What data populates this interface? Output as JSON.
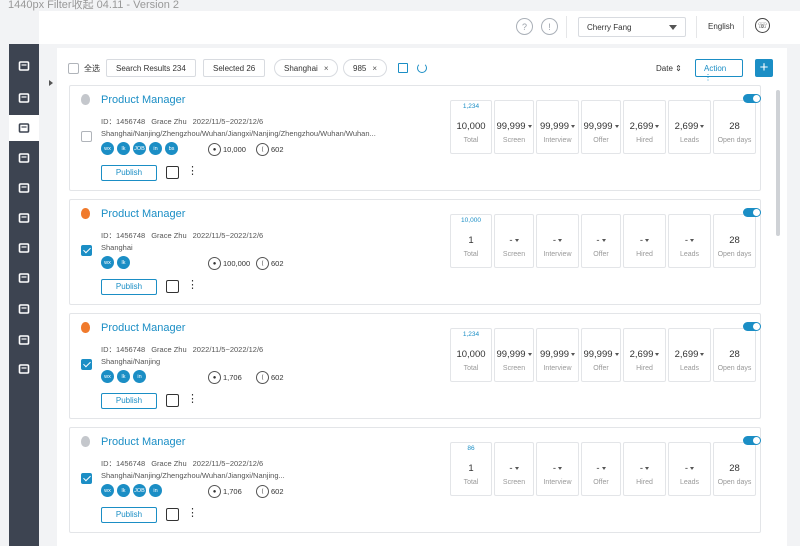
{
  "topcap": "1440px Filter收起 04.11 - Version 2",
  "header": {
    "user": "Cherry Fang",
    "language": "English"
  },
  "sidebar": {
    "icons": [
      "dashboard-icon",
      "contacts-icon",
      "briefcase-icon",
      "users-icon",
      "resume-icon",
      "add-user-icon",
      "report-icon",
      "chart-icon",
      "person-icon",
      "feedback-icon",
      "id-card-icon"
    ],
    "active_index": 2
  },
  "filterbar": {
    "select_all": "全选",
    "search_results": "Search Results 234",
    "selected": "Selected 26",
    "chip_city": "Shanghai",
    "chip_tag": "985",
    "sort": "Date",
    "action": "Action",
    "add": "+"
  },
  "metric_labels": [
    "Total",
    "Screen",
    "Interview",
    "Offer",
    "Hired",
    "Leads",
    "Open days"
  ],
  "cards": [
    {
      "title": "Product Manager",
      "hot": false,
      "checked": false,
      "id": "ID：1456748",
      "owner": "Grace Zhu",
      "date_range": "2022/11/5~2022/12/6",
      "locations": "Shanghai/Nanjing/Zhengzhou/Wuhan/Jiangxi/Nanjing/Zhengzhou/Wuhan/Wuhan...",
      "channels": [
        "wechat",
        "link",
        "job",
        "in",
        "boss"
      ],
      "views": "10,000",
      "shares": "602",
      "publish": "Publish",
      "top_badge": "1,234",
      "metrics": [
        {
          "value": "10,000",
          "dropdown": false
        },
        {
          "value": "99,999",
          "dropdown": true
        },
        {
          "value": "99,999",
          "dropdown": true
        },
        {
          "value": "99,999",
          "dropdown": true
        },
        {
          "value": "2,699",
          "dropdown": true
        },
        {
          "value": "2,699",
          "dropdown": true
        },
        {
          "value": "28",
          "dropdown": false
        }
      ]
    },
    {
      "title": "Product Manager",
      "hot": true,
      "checked": true,
      "id": "ID：1456748",
      "owner": "Grace Zhu",
      "date_range": "2022/11/5~2022/12/6",
      "locations": "Shanghai",
      "channels": [
        "wechat",
        "link"
      ],
      "views": "100,000",
      "shares": "602",
      "publish": "Publish",
      "top_badge": "10,000",
      "metrics": [
        {
          "value": "1",
          "dropdown": false
        },
        {
          "value": "-",
          "dropdown": true
        },
        {
          "value": "-",
          "dropdown": true
        },
        {
          "value": "-",
          "dropdown": true
        },
        {
          "value": "-",
          "dropdown": true
        },
        {
          "value": "-",
          "dropdown": true
        },
        {
          "value": "28",
          "dropdown": false
        }
      ]
    },
    {
      "title": "Product Manager",
      "hot": true,
      "checked": true,
      "id": "ID：1456748",
      "owner": "Grace Zhu",
      "date_range": "2022/11/5~2022/12/6",
      "locations": "Shanghai/Nanjing",
      "channels": [
        "wechat",
        "link",
        "in"
      ],
      "views": "1,706",
      "shares": "602",
      "publish": "Publish",
      "top_badge": "1,234",
      "metrics": [
        {
          "value": "10,000",
          "dropdown": false
        },
        {
          "value": "99,999",
          "dropdown": true
        },
        {
          "value": "99,999",
          "dropdown": true
        },
        {
          "value": "99,999",
          "dropdown": true
        },
        {
          "value": "2,699",
          "dropdown": true
        },
        {
          "value": "2,699",
          "dropdown": true
        },
        {
          "value": "28",
          "dropdown": false
        }
      ]
    },
    {
      "title": "Product Manager",
      "hot": false,
      "checked": true,
      "id": "ID：1456748",
      "owner": "Grace Zhu",
      "date_range": "2022/11/5~2022/12/6",
      "locations": "Shanghai/Nanjing/Zhengzhou/Wuhan/Jiangxi/Nanjing...",
      "channels": [
        "wechat",
        "link",
        "job",
        "in"
      ],
      "views": "1,706",
      "shares": "602",
      "publish": "Publish",
      "top_badge": "86",
      "metrics": [
        {
          "value": "1",
          "dropdown": false
        },
        {
          "value": "-",
          "dropdown": true
        },
        {
          "value": "-",
          "dropdown": true
        },
        {
          "value": "-",
          "dropdown": true
        },
        {
          "value": "-",
          "dropdown": true
        },
        {
          "value": "-",
          "dropdown": true
        },
        {
          "value": "28",
          "dropdown": false
        }
      ]
    }
  ]
}
